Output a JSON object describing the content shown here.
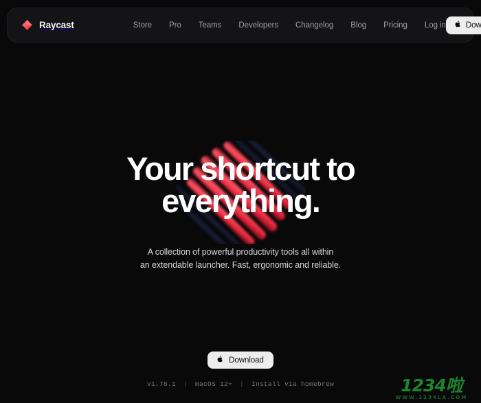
{
  "site": {
    "background_color": "#09090a",
    "accent_color": "#ff4a57"
  },
  "navbar": {
    "brand_name": "Raycast",
    "logo_icon": "raycast-diamond-icon",
    "links": [
      {
        "label": "Store"
      },
      {
        "label": "Pro"
      },
      {
        "label": "Teams"
      },
      {
        "label": "Developers"
      },
      {
        "label": "Changelog"
      },
      {
        "label": "Blog"
      },
      {
        "label": "Pricing"
      },
      {
        "label": "Log in"
      }
    ],
    "download_button": {
      "label": "Download",
      "icon": "apple-logo-icon",
      "glyph": ""
    }
  },
  "hero": {
    "headline_line1": "Your shortcut to",
    "headline_line2": "everything.",
    "subtitle_line1": "A collection of powerful productivity tools all within",
    "subtitle_line2": "an extendable launcher. Fast, ergonomic and reliable."
  },
  "cta": {
    "download_button": {
      "label": "Download",
      "icon": "apple-logo-icon",
      "glyph": ""
    },
    "version": "v1.78.1",
    "os_requirement": "macOS 12+",
    "homebrew_label": "Install via homebrew",
    "separator": "|"
  },
  "watermark": {
    "main_text": "1234啦",
    "sub_text": "WWW.1234LA.COM",
    "color": "#1f8a2f"
  }
}
